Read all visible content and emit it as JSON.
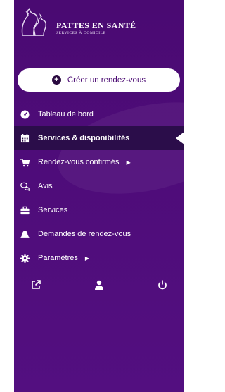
{
  "brand": {
    "name": "PATTES EN SANTÉ",
    "tagline": "SERVICES À DOMICILE"
  },
  "create_button": {
    "label": "Créer un rendez-vous",
    "icon": "plus-circle-icon"
  },
  "menu": [
    {
      "label": "Tableau de bord",
      "icon": "dashboard-gauge-icon",
      "active": false,
      "has_submenu": false
    },
    {
      "label": "Services & disponibilités",
      "icon": "calendar-icon",
      "active": true,
      "has_submenu": false
    },
    {
      "label": "Rendez-vous confirmés",
      "icon": "cart-icon",
      "active": false,
      "has_submenu": true
    },
    {
      "label": "Avis",
      "icon": "comments-icon",
      "active": false,
      "has_submenu": false
    },
    {
      "label": "Services",
      "icon": "briefcase-icon",
      "active": false,
      "has_submenu": false
    },
    {
      "label": "Demandes de rendez-vous",
      "icon": "bell-icon",
      "active": false,
      "has_submenu": false
    },
    {
      "label": "Paramètres",
      "icon": "gear-icon",
      "active": false,
      "has_submenu": true
    }
  ],
  "bottom_icons": [
    "external-link-icon",
    "user-icon",
    "power-icon"
  ],
  "colors": {
    "sidebar": "#4e0c79",
    "active_row": "#2b0d4a",
    "button_bg": "#ffffff",
    "button_text": "#4a0a72"
  }
}
